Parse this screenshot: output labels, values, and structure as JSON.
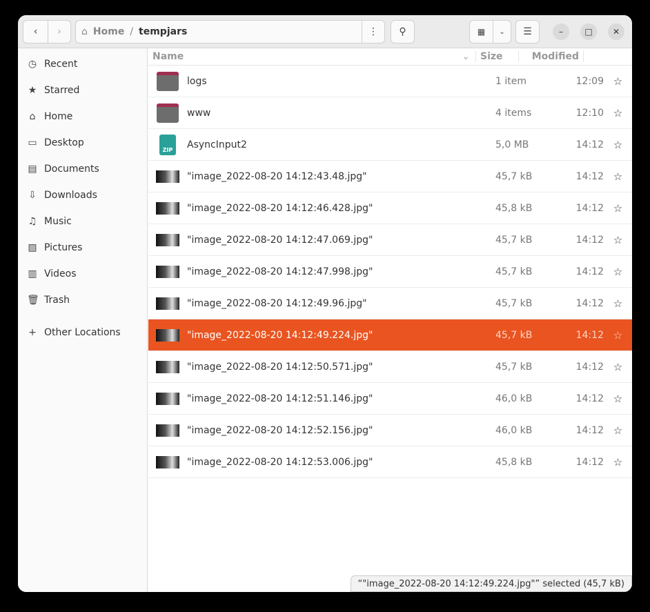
{
  "breadcrumb": {
    "home": "Home",
    "current": "tempjars"
  },
  "sidebar": [
    {
      "icon": "clock-icon",
      "glyph": "◷",
      "label": "Recent"
    },
    {
      "icon": "star-icon",
      "glyph": "★",
      "label": "Starred"
    },
    {
      "icon": "home-icon",
      "glyph": "⌂",
      "label": "Home"
    },
    {
      "icon": "desktop-icon",
      "glyph": "▭",
      "label": "Desktop"
    },
    {
      "icon": "document-icon",
      "glyph": "▤",
      "label": "Documents"
    },
    {
      "icon": "download-icon",
      "glyph": "⇩",
      "label": "Downloads"
    },
    {
      "icon": "music-icon",
      "glyph": "♫",
      "label": "Music"
    },
    {
      "icon": "pictures-icon",
      "glyph": "▨",
      "label": "Pictures"
    },
    {
      "icon": "video-icon",
      "glyph": "▥",
      "label": "Videos"
    },
    {
      "icon": "trash-icon",
      "glyph": "🗑",
      "label": "Trash"
    },
    {
      "icon": "plus-icon",
      "glyph": "+",
      "label": "Other Locations"
    }
  ],
  "columns": {
    "name": "Name",
    "size": "Size",
    "modified": "Modified"
  },
  "files": [
    {
      "type": "folder",
      "name": "logs",
      "size": "1 item",
      "modified": "12:09"
    },
    {
      "type": "folder",
      "name": "www",
      "size": "4 items",
      "modified": "12:10"
    },
    {
      "type": "zip",
      "name": "AsyncInput2",
      "size": "5,0 MB",
      "modified": "14:12"
    },
    {
      "type": "image",
      "name": "\"image_2022-08-20 14:12:43.48.jpg\"",
      "size": "45,7 kB",
      "modified": "14:12"
    },
    {
      "type": "image",
      "name": "\"image_2022-08-20 14:12:46.428.jpg\"",
      "size": "45,8 kB",
      "modified": "14:12"
    },
    {
      "type": "image",
      "name": "\"image_2022-08-20 14:12:47.069.jpg\"",
      "size": "45,7 kB",
      "modified": "14:12"
    },
    {
      "type": "image",
      "name": "\"image_2022-08-20 14:12:47.998.jpg\"",
      "size": "45,7 kB",
      "modified": "14:12"
    },
    {
      "type": "image",
      "name": "\"image_2022-08-20 14:12:49.96.jpg\"",
      "size": "45,7 kB",
      "modified": "14:12"
    },
    {
      "type": "image",
      "name": "\"image_2022-08-20 14:12:49.224.jpg\"",
      "size": "45,7 kB",
      "modified": "14:12",
      "selected": true
    },
    {
      "type": "image",
      "name": "\"image_2022-08-20 14:12:50.571.jpg\"",
      "size": "45,7 kB",
      "modified": "14:12"
    },
    {
      "type": "image",
      "name": "\"image_2022-08-20 14:12:51.146.jpg\"",
      "size": "46,0 kB",
      "modified": "14:12"
    },
    {
      "type": "image",
      "name": "\"image_2022-08-20 14:12:52.156.jpg\"",
      "size": "46,0 kB",
      "modified": "14:12"
    },
    {
      "type": "image",
      "name": "\"image_2022-08-20 14:12:53.006.jpg\"",
      "size": "45,8 kB",
      "modified": "14:12"
    }
  ],
  "zip_label": "ZIP",
  "status": "“\"image_2022-08-20 14:12:49.224.jpg\"” selected  (45,7 kB)",
  "colors": {
    "accent": "#E95420"
  }
}
